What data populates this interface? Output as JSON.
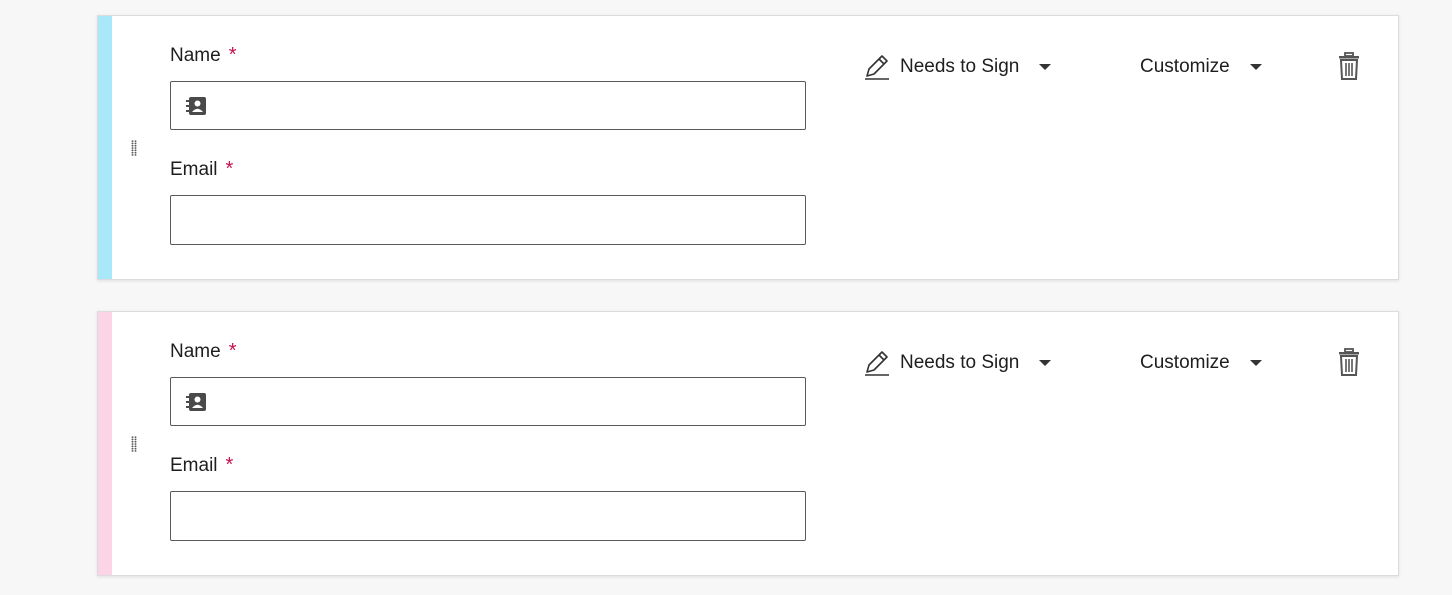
{
  "recipients": [
    {
      "stripe_color": "#a8e8f8",
      "name_label": "Name",
      "name_required": "*",
      "name_value": "",
      "email_label": "Email",
      "email_required": "*",
      "email_value": "",
      "role_label": "Needs to Sign",
      "customize_label": "Customize"
    },
    {
      "stripe_color": "#fbd5e6",
      "name_label": "Name",
      "name_required": "*",
      "name_value": "",
      "email_label": "Email",
      "email_required": "*",
      "email_value": "",
      "role_label": "Needs to Sign",
      "customize_label": "Customize"
    }
  ],
  "icons": {
    "contact": "contact-card-icon",
    "role": "pen-icon",
    "dropdown": "caret-down-icon",
    "delete": "trash-icon",
    "drag": "drag-handle-icon"
  }
}
